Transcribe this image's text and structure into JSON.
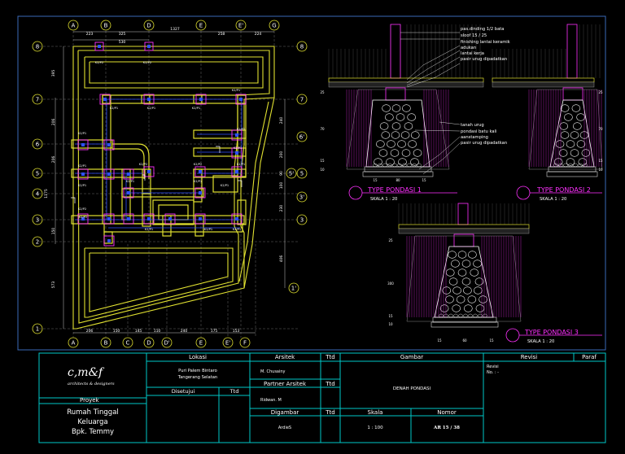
{
  "colors": {
    "background": "#000000",
    "border": "#3a6ab8",
    "titleblock": "#00c8c8",
    "wall": "#e0e030",
    "column": "#ff30ff",
    "rebar": "#3050ff",
    "text": "#ffffff",
    "dimension": "#b0b0b0",
    "axis_circle": "#e0e030"
  },
  "plan": {
    "grid_top": [
      "A",
      "B",
      "D",
      "E",
      "E'",
      "G"
    ],
    "grid_bottom": [
      "A",
      "B",
      "C",
      "D",
      "D'",
      "E",
      "E'",
      "F"
    ],
    "grid_rows_left": [
      "8",
      "7",
      "6",
      "5",
      "4",
      "3",
      "2",
      "1"
    ],
    "grid_rows_right": [
      "8",
      "7",
      "6'",
      "5",
      "5'",
      "3'",
      "3",
      "1'"
    ],
    "dims_top": [
      "223",
      "325",
      "1327",
      "258",
      "224",
      "530"
    ],
    "dims_bottom": [
      "206",
      "150",
      "145",
      "110",
      "240",
      "175",
      "153"
    ],
    "dims_left": [
      "395",
      "206",
      "206",
      "150",
      "1175",
      "573"
    ],
    "dims_right": [
      "240",
      "200",
      "90",
      "100",
      "230",
      "406"
    ],
    "column_tags": [
      "K2/P2",
      "K2/P2",
      "K2/P1",
      "K2/P1",
      "K2/P1",
      "K2/P1",
      "K2/P1",
      "K2/P2",
      "K2/P1",
      "K2/P1",
      "K2/P2",
      "K2/P2",
      "K2/P1",
      "K2/P1",
      "K2/P1",
      "K2/P1",
      "K2/P1",
      "K2/P2",
      "K2/P2",
      "K2/P1",
      "K2/P1",
      "K2/P1"
    ]
  },
  "sections": {
    "labels": [
      "pas.dinding 1/2 bata",
      "sloof 15 / 25",
      "finishing lantai keramik",
      "adukan",
      "lantai kerja",
      "pasir urug dipadatkan"
    ],
    "labels2": [
      "tanah urug",
      "pondasi batu kali",
      "aanstamping",
      "pasir urug dipadatkan"
    ],
    "type1_title": "TYPE PONDASI 1",
    "type1_scale": "SKALA  1  :  20",
    "type2_title": "TYPE PONDASI 2",
    "type2_scale": "SKALA 1  :  20",
    "type3_title": "TYPE PONDASI 3",
    "type3_scale": "SKALA 1  :  20",
    "dims_t1": [
      "25",
      "70",
      "15",
      "10",
      "15",
      "80",
      "15"
    ],
    "dims_t2": [
      "25",
      "70",
      "15",
      "10"
    ],
    "dims_t3": [
      "25",
      "300",
      "15",
      "10",
      "15",
      "60",
      "15"
    ]
  },
  "titleblock": {
    "logo": "c,m&f",
    "logo_sub": "architects & designers",
    "proyek_label": "Proyek",
    "proyek_line1": "Rumah Tinggal",
    "proyek_line2": "Keluarga",
    "proyek_line3": "Bpk. Temmy",
    "lokasi_label": "Lokasi",
    "lokasi_line1": "Puri Palem Bintaro",
    "lokasi_line2": "Tangerang Selatan",
    "disetujui_label": "Disetujui",
    "ttd_label": "Ttd",
    "arsitek_label": "Arsitek",
    "arsitek_name": "M. Chusainy",
    "partner_label": "Partner Arsitek",
    "partner_name": "Ridwan. M",
    "digambar_label": "Digambar",
    "digambar_name": "ArdieS",
    "gambar_label": "Gambar",
    "gambar_value": "DENAH PONDASI",
    "skala_label": "Skala",
    "skala_value": "1 : 100",
    "nomor_label": "Nomor",
    "nomor_value": "AR 15 / 38",
    "revisi_label": "Revisi",
    "paraf_label": "Paraf",
    "revisi_entry1": "Revisi",
    "revisi_entry2": "No. : -"
  }
}
